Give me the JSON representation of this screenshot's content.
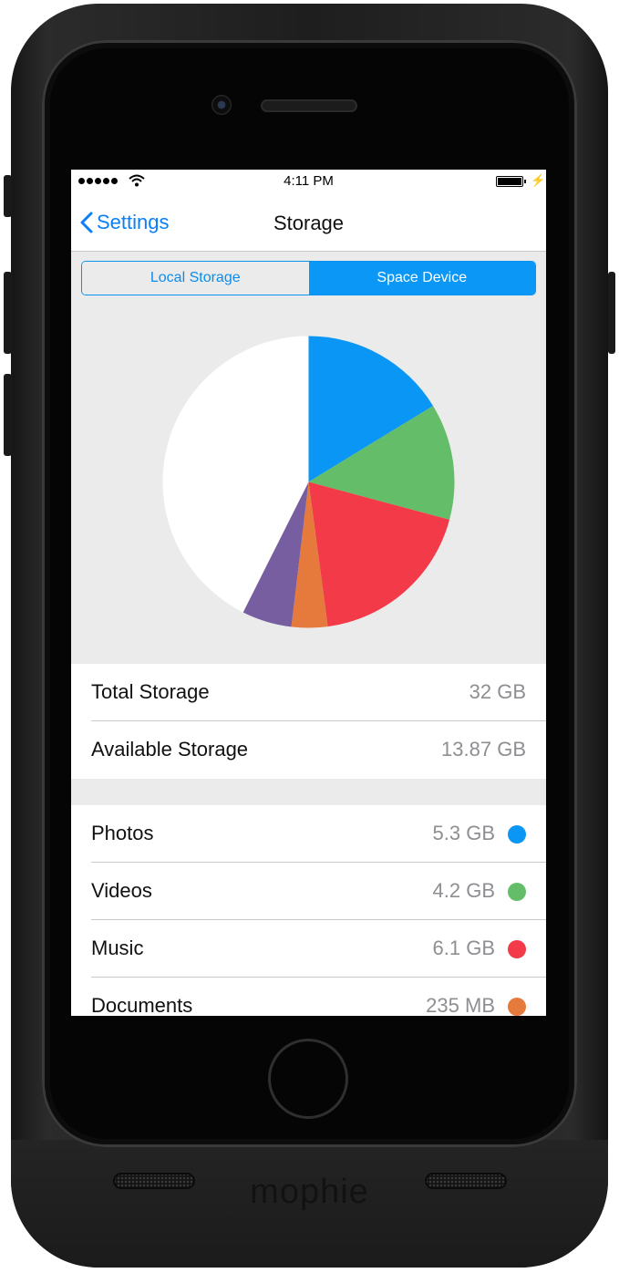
{
  "device": {
    "brand": "mophie"
  },
  "status_bar": {
    "time": "4:11 PM"
  },
  "nav": {
    "back_label": "Settings",
    "title": "Storage"
  },
  "segments": [
    {
      "label": "Local Storage",
      "selected": false
    },
    {
      "label": "Space Device",
      "selected": true
    }
  ],
  "summary": {
    "total": {
      "label": "Total Storage",
      "value": "32 GB"
    },
    "available": {
      "label": "Available Storage",
      "value": "13.87 GB"
    }
  },
  "categories": [
    {
      "label": "Photos",
      "value": "5.3 GB",
      "color": "#0a96f5"
    },
    {
      "label": "Videos",
      "value": "4.2 GB",
      "color": "#64bd68"
    },
    {
      "label": "Music",
      "value": "6.1 GB",
      "color": "#f23a48"
    },
    {
      "label": "Documents",
      "value": "235 MB",
      "color": "#e57a3c"
    }
  ],
  "chart_data": {
    "type": "pie",
    "slices": [
      {
        "label": "Photos",
        "value": 5.3,
        "color": "#0a96f5"
      },
      {
        "label": "Videos",
        "value": 4.2,
        "color": "#64bd68"
      },
      {
        "label": "Music",
        "value": 6.1,
        "color": "#f23a48"
      },
      {
        "label": "Documents",
        "value": 1.3,
        "color": "#e57a3c"
      },
      {
        "label": "",
        "value": 1.8,
        "color": "#765ea0"
      },
      {
        "label": "Available",
        "value": 13.87,
        "color": "#ffffff"
      }
    ],
    "start": "12 o'clock",
    "direction": "clockwise"
  }
}
